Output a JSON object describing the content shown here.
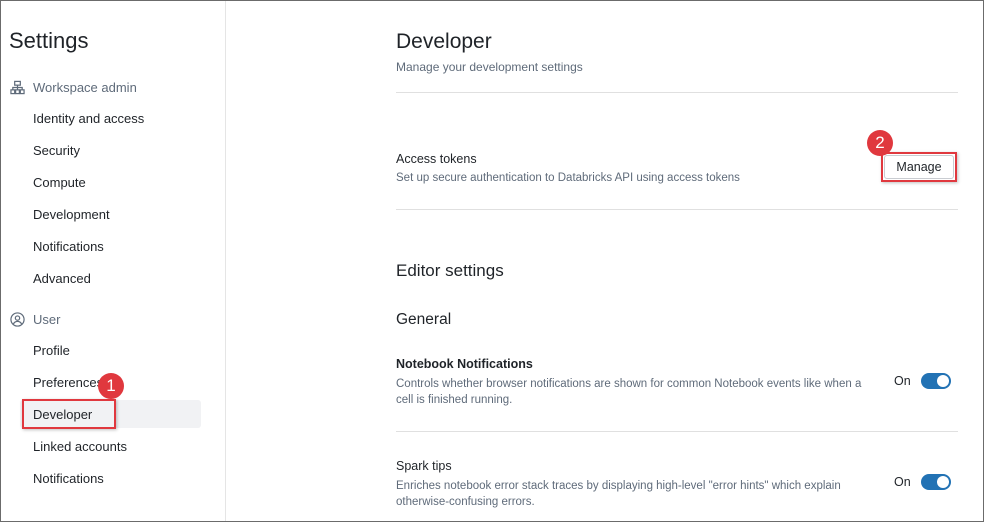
{
  "sidebar": {
    "title": "Settings",
    "workspace_admin": {
      "label": "Workspace admin",
      "icon": "org-chart-icon",
      "items": [
        "Identity and access",
        "Security",
        "Compute",
        "Development",
        "Notifications",
        "Advanced"
      ]
    },
    "user": {
      "label": "User",
      "icon": "user-circle-icon",
      "items": [
        "Profile",
        "Preferences",
        "Developer",
        "Linked accounts",
        "Notifications"
      ],
      "active": "Developer"
    }
  },
  "annotations": {
    "badge1": "1",
    "badge2": "2",
    "color": "#e0383e"
  },
  "main": {
    "title": "Developer",
    "subtitle": "Manage your development settings",
    "access_tokens": {
      "title": "Access tokens",
      "description": "Set up secure authentication to Databricks API using access tokens",
      "button": "Manage"
    },
    "editor_settings": "Editor settings",
    "general": "General",
    "notebook_notifications": {
      "title": "Notebook Notifications",
      "description": "Controls whether browser notifications are shown for common Notebook events like when a cell is finished running.",
      "state": "On"
    },
    "spark_tips": {
      "title": "Spark tips",
      "description": "Enriches notebook error stack traces by displaying high-level \"error hints\" which explain otherwise-confusing errors.",
      "state": "On"
    }
  },
  "colors": {
    "accent": "#2272b4",
    "annotation": "#e0383e"
  }
}
